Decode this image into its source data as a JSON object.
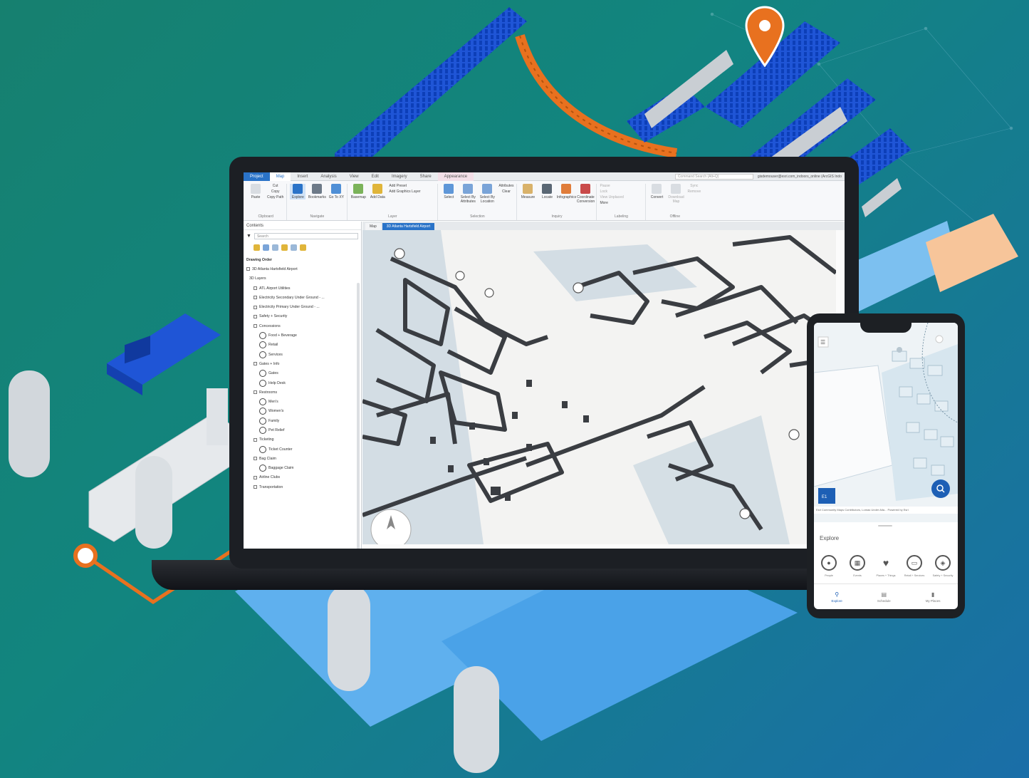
{
  "colors": {
    "accent": "#2a73c8",
    "orange": "#e8711f",
    "bg_start": "#16806f",
    "bg_end": "#1a6ea8",
    "wall": "#3a3d42",
    "water": "#b9d3e2"
  },
  "ribbon": {
    "tabs": [
      "Project",
      "Map",
      "Insert",
      "Analysis",
      "View",
      "Edit",
      "Imagery",
      "Share",
      "Appearance"
    ],
    "command_search": "Command Search (Alt+Q)",
    "user": "gisdemouser@esri.com_indoors_online (ArcGIS Indo",
    "groups": [
      {
        "label": "Clipboard",
        "buttons": [
          "Paste",
          "Cut",
          "Copy",
          "Copy Path"
        ]
      },
      {
        "label": "Navigate",
        "buttons": [
          "Explore",
          "Bookmarks",
          "Go To XY"
        ]
      },
      {
        "label": "Layer",
        "buttons": [
          "Basemap",
          "Add Data",
          "Add Preset",
          "Add Graphics Layer"
        ]
      },
      {
        "label": "Selection",
        "buttons": [
          "Select",
          "Select By Attributes",
          "Select By Location",
          "Attributes",
          "Clear"
        ]
      },
      {
        "label": "Inquiry",
        "buttons": [
          "Measure",
          "Locate",
          "Infographics",
          "Coordinate Conversion"
        ]
      },
      {
        "label": "Labeling",
        "buttons": [
          "Pause",
          "Lock",
          "View Unplaced",
          "More"
        ]
      },
      {
        "label": "Offline",
        "buttons": [
          "Convert",
          "Download Map",
          "Sync",
          "Remove"
        ]
      }
    ]
  },
  "contents": {
    "title": "Contents",
    "search_placeholder": "Search",
    "drawing_order": "Drawing Order",
    "items": [
      {
        "label": "3D Atlanta Hartsfield Airport",
        "kind": "root"
      },
      {
        "label": "3D Layers",
        "kind": "group"
      },
      {
        "label": "ATL Airport Utilities",
        "kind": "check"
      },
      {
        "label": "Electricity Secondary Under Ground - ...",
        "kind": "check"
      },
      {
        "label": "Electricity Primary Under Ground - ...",
        "kind": "check"
      },
      {
        "label": "Safety + Security",
        "kind": "check"
      },
      {
        "label": "Concessions",
        "kind": "check"
      },
      {
        "label": "Food + Beverage",
        "kind": "sym"
      },
      {
        "label": "Retail",
        "kind": "sym"
      },
      {
        "label": "Services",
        "kind": "sym"
      },
      {
        "label": "Gates + Info",
        "kind": "check"
      },
      {
        "label": "Gates",
        "kind": "sym"
      },
      {
        "label": "Help Desk",
        "kind": "sym"
      },
      {
        "label": "Restrooms",
        "kind": "check"
      },
      {
        "label": "Men's",
        "kind": "sym"
      },
      {
        "label": "Women's",
        "kind": "sym"
      },
      {
        "label": "Family",
        "kind": "sym"
      },
      {
        "label": "Pet Relief",
        "kind": "sym"
      },
      {
        "label": "Ticketing",
        "kind": "check"
      },
      {
        "label": "Ticket Counter",
        "kind": "sym"
      },
      {
        "label": "Bag Claim",
        "kind": "check"
      },
      {
        "label": "Baggage Claim",
        "kind": "sym"
      },
      {
        "label": "Airline Clubs",
        "kind": "check"
      },
      {
        "label": "Transportation",
        "kind": "check"
      }
    ]
  },
  "map": {
    "tabs": [
      "Map",
      "3D Atlanta Hartsfield Airport"
    ]
  },
  "phone": {
    "floor_labels": [
      "E1"
    ],
    "attribution": "Esri Community Maps Contributors, Lomas Under Atla...   Powered by Esri",
    "explore_title": "Explore",
    "categories": [
      {
        "label": "People",
        "icon": "person-icon"
      },
      {
        "label": "Events",
        "icon": "calendar-icon"
      },
      {
        "label": "Places + Things",
        "icon": "pin-icon"
      },
      {
        "label": "Retail + Services",
        "icon": "shop-icon"
      },
      {
        "label": "Safety + Security",
        "icon": "shield-icon"
      }
    ],
    "nav": [
      "Explore",
      "Schedule",
      "My Places"
    ]
  }
}
